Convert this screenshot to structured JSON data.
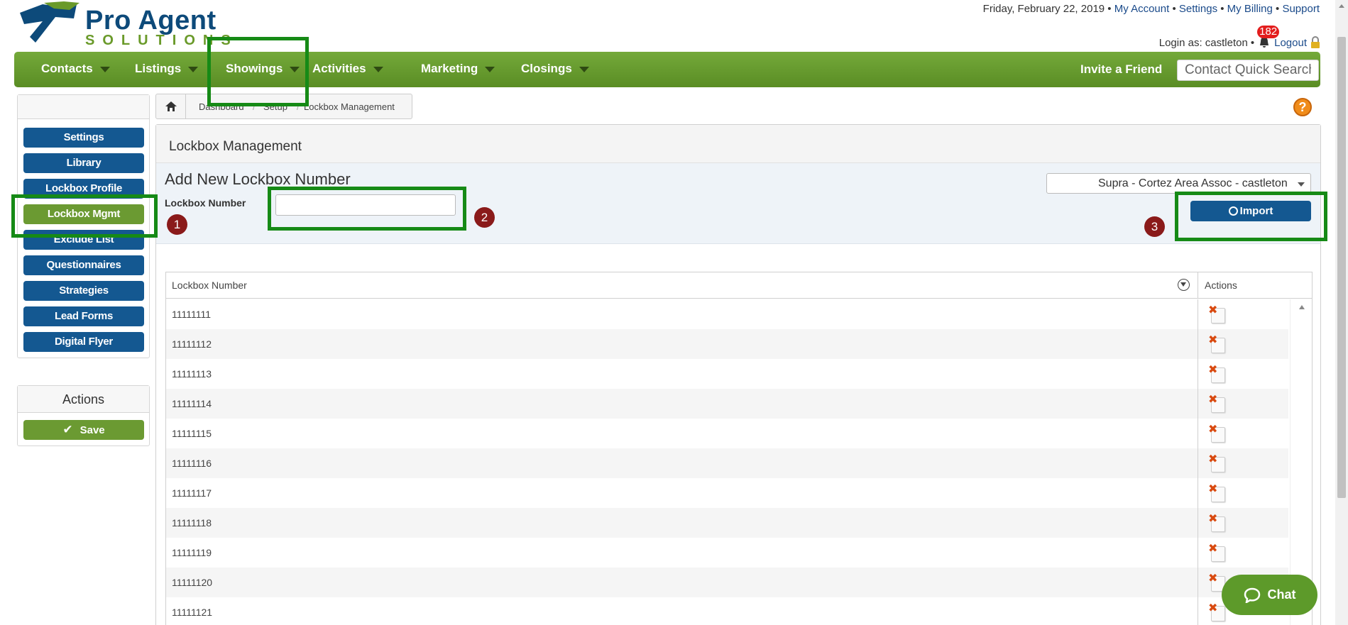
{
  "header": {
    "logo_main": "Pro Agent",
    "logo_sub": "SOLUTIONS",
    "date": "Friday, February 22, 2019",
    "top_links": [
      "My Account",
      "Settings",
      "My Billing",
      "Support"
    ],
    "login_text": "Login as: castleton",
    "notification_count": "182",
    "logout_label": "Logout"
  },
  "nav": {
    "items": [
      "Contacts",
      "Listings",
      "Showings",
      "Activities",
      "Marketing",
      "Closings"
    ],
    "invite_label": "Invite a Friend",
    "quick_search_placeholder": "Contact Quick Search"
  },
  "sidebar": {
    "items": [
      "Settings",
      "Library",
      "Lockbox Profile",
      "Lockbox Mgmt",
      "Exclude List",
      "Questionnaires",
      "Strategies",
      "Lead Forms",
      "Digital Flyer"
    ],
    "active_item": "Lockbox Mgmt",
    "actions_title": "Actions",
    "save_label": "Save"
  },
  "breadcrumb": [
    "Dashboard",
    "Setup",
    "Lockbox Management"
  ],
  "main": {
    "title": "Lockbox Management",
    "add_title": "Add New Lockbox Number",
    "lockbox_label": "Lockbox Number",
    "lockbox_value": "",
    "select_value": "Supra - Cortez Area Assoc - castleton",
    "import_label": "Import"
  },
  "annotations": [
    "1",
    "2",
    "3"
  ],
  "table": {
    "columns": [
      "Lockbox Number",
      "Actions"
    ],
    "rows": [
      "11111111",
      "11111112",
      "11111113",
      "11111114",
      "11111115",
      "11111116",
      "11111117",
      "11111118",
      "11111119",
      "11111120",
      "11111121"
    ]
  },
  "chat_label": "Chat",
  "colors": {
    "nav_green": "#5a8d24",
    "button_blue": "#145891",
    "highlight_green": "#168a16",
    "annotation_red": "#8a1a1a"
  }
}
